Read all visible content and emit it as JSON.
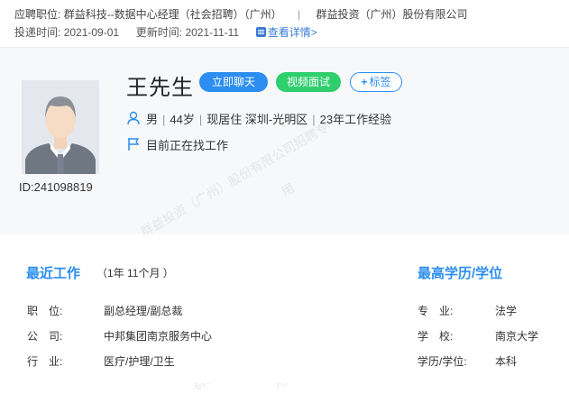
{
  "header": {
    "position_label": "应聘职位:",
    "position_value": "群益科技--数据中心经理（社会招聘）（广州）",
    "company": "群益投资（广州）股份有限公司",
    "delivered_label": "投递时间:",
    "delivered_value": "2021-09-01",
    "updated_label": "更新时间:",
    "updated_value": "2021-11-11",
    "detail_link": "查看详情>"
  },
  "profile": {
    "name": "王先生",
    "chat_button": "立即聊天",
    "video_button": "视频面试",
    "tag_button": "标签",
    "gender": "男",
    "age": "44岁",
    "residence": "现居住 深圳-光明区",
    "experience": "23年工作经验",
    "status": "目前正在找工作",
    "id": "ID:241098819"
  },
  "recent_work": {
    "title": "最近工作",
    "duration": "（1年 11个月 ）",
    "rows": [
      {
        "label": "职　位:",
        "value": "副总经理/副总裁"
      },
      {
        "label": "公　司:",
        "value": "中邦集团南京服务中心"
      },
      {
        "label": "行　业:",
        "value": "医疗/护理/卫生"
      }
    ]
  },
  "education": {
    "title": "最高学历/学位",
    "rows": [
      {
        "label": "专　业:",
        "value": "法学"
      },
      {
        "label": "学　校:",
        "value": "南京大学"
      },
      {
        "label": "学历/学位:",
        "value": "本科"
      }
    ]
  },
  "watermark": {
    "line1": "群益投资（广州）股份有限公司招聘专",
    "line2": "用"
  },
  "colors": {
    "accent": "#2b8ef0",
    "green": "#2fcf6e"
  }
}
